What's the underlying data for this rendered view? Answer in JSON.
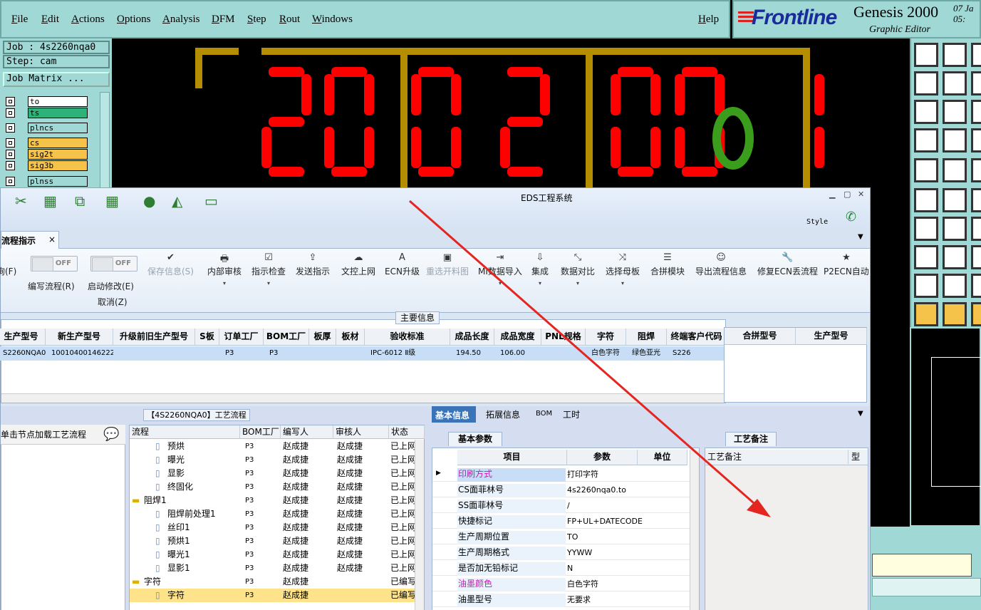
{
  "genesis": {
    "menu": [
      "File",
      "Edit",
      "Actions",
      "Options",
      "Analysis",
      "DFM",
      "Step",
      "Rout",
      "Windows"
    ],
    "help": "Help",
    "logo": "Frontline",
    "title": "Genesis 2000",
    "subtitle": "Graphic Editor",
    "date_line1": "07  Ja",
    "date_line2": "05:",
    "job": "Job : 4s2260nqa0",
    "step": "Step: cam",
    "job_matrix": "Job Matrix ...",
    "layers": [
      {
        "name": "to",
        "color": "#ffffff"
      },
      {
        "name": "ts",
        "color": "#2db37a"
      },
      {
        "name": "plncs",
        "color": "#9fd8d5"
      },
      {
        "name": "cs",
        "color": "#f5c34a"
      },
      {
        "name": "sig2t",
        "color": "#f5c34a"
      },
      {
        "name": "sig3b",
        "color": "#f5c34a"
      },
      {
        "name": "plnss",
        "color": "#9fd8d5"
      }
    ],
    "canvas_digits": "2002001"
  },
  "eds": {
    "window_title": "EDS工程系统",
    "style_label": "Style",
    "tab": "流程指示",
    "ribbon": [
      {
        "label": "询(F)",
        "icon": "",
        "disabled": false
      },
      {
        "label": "编写流程(R)",
        "icon": "toggle",
        "disabled": false
      },
      {
        "label": "启动修改(E)",
        "icon": "toggle",
        "disabled": false
      },
      {
        "label": "保存信息(S)",
        "icon": "✔",
        "disabled": true
      },
      {
        "label": "内部审核",
        "icon": "🖶",
        "disabled": false
      },
      {
        "label": "指示检查",
        "icon": "☑",
        "disabled": false
      },
      {
        "label": "发送指示",
        "icon": "⇪",
        "disabled": false
      },
      {
        "label": "文控上网",
        "icon": "☁",
        "disabled": false
      },
      {
        "label": "ECN升级",
        "icon": "A",
        "disabled": false
      },
      {
        "label": "重选开料图",
        "icon": "▣",
        "disabled": true
      },
      {
        "label": "MI数据导入",
        "icon": "⇥",
        "disabled": false
      },
      {
        "label": "集成",
        "icon": "⇩",
        "disabled": false
      },
      {
        "label": "数据对比",
        "icon": "⤡",
        "disabled": false
      },
      {
        "label": "选择母板",
        "icon": "⤨",
        "disabled": false
      },
      {
        "label": "合拼模块",
        "icon": "☰",
        "disabled": false
      },
      {
        "label": "导出流程信息",
        "icon": "☺",
        "disabled": false
      },
      {
        "label": "修复ECN丢流程",
        "icon": "🔧",
        "disabled": false
      },
      {
        "label": "P2ECN自动",
        "icon": "★",
        "disabled": false
      }
    ],
    "toggle_off": "OFF",
    "cancel_label": "取消(Z)",
    "main_info_label": "主要信息",
    "main_columns": [
      "生产型号",
      "新生产型号",
      "升级前旧生产型号",
      "S板",
      "订单工厂",
      "BOM工厂",
      "板厚",
      "板材",
      "验收标准",
      "成品长度",
      "成品宽度",
      "PNL规格",
      "字符",
      "阻焊",
      "终端客户代码"
    ],
    "main_row": [
      "S2260NQA0",
      "10010400146222",
      "",
      "",
      "P3",
      "P3",
      "",
      "",
      "IPC-6012 Ⅱ级",
      "194.50",
      "106.00",
      "",
      "白色字符",
      "绿色亚光",
      "S226"
    ],
    "side_columns": [
      "合拼型号",
      "生产型号"
    ],
    "process_title": "【4S2260NQA0】工艺流程",
    "left_hint": "单击节点加载工艺流程",
    "proc_columns": [
      "流程",
      "BOM工厂",
      "编写人",
      "审核人",
      "状态"
    ],
    "proc_rows": [
      {
        "name": "预烘",
        "bom": "P3",
        "writer": "赵成捷",
        "reviewer": "赵成捷",
        "status": "已上网",
        "indent": 2,
        "folder": false
      },
      {
        "name": "曝光",
        "bom": "P3",
        "writer": "赵成捷",
        "reviewer": "赵成捷",
        "status": "已上网",
        "indent": 2,
        "folder": false
      },
      {
        "name": "显影",
        "bom": "P3",
        "writer": "赵成捷",
        "reviewer": "赵成捷",
        "status": "已上网",
        "indent": 2,
        "folder": false
      },
      {
        "name": "终固化",
        "bom": "P3",
        "writer": "赵成捷",
        "reviewer": "赵成捷",
        "status": "已上网",
        "indent": 2,
        "folder": false
      },
      {
        "name": "阻焊1",
        "bom": "P3",
        "writer": "赵成捷",
        "reviewer": "赵成捷",
        "status": "已上网",
        "indent": 1,
        "folder": true
      },
      {
        "name": "阻焊前处理1",
        "bom": "P3",
        "writer": "赵成捷",
        "reviewer": "赵成捷",
        "status": "已上网",
        "indent": 2,
        "folder": false
      },
      {
        "name": "丝印1",
        "bom": "P3",
        "writer": "赵成捷",
        "reviewer": "赵成捷",
        "status": "已上网",
        "indent": 2,
        "folder": false
      },
      {
        "name": "预烘1",
        "bom": "P3",
        "writer": "赵成捷",
        "reviewer": "赵成捷",
        "status": "已上网",
        "indent": 2,
        "folder": false
      },
      {
        "name": "曝光1",
        "bom": "P3",
        "writer": "赵成捷",
        "reviewer": "赵成捷",
        "status": "已上网",
        "indent": 2,
        "folder": false
      },
      {
        "name": "显影1",
        "bom": "P3",
        "writer": "赵成捷",
        "reviewer": "赵成捷",
        "status": "已上网",
        "indent": 2,
        "folder": false
      },
      {
        "name": "字符",
        "bom": "P3",
        "writer": "赵成捷",
        "reviewer": "",
        "status": "已编写",
        "indent": 1,
        "folder": true
      },
      {
        "name": "字符",
        "bom": "P3",
        "writer": "赵成捷",
        "reviewer": "",
        "status": "已编写",
        "indent": 2,
        "folder": false,
        "selected": true
      }
    ],
    "info_tabs": [
      "基本信息",
      "拓展信息",
      "BOM",
      "工时"
    ],
    "basic_params_label": "基本参数",
    "param_columns": [
      "项目",
      "参数",
      "单位"
    ],
    "params": [
      {
        "key": "印刷方式",
        "value": "打印字符",
        "pink": true,
        "current": true
      },
      {
        "key": "CS面菲林号",
        "value": "4s2260nqa0.to"
      },
      {
        "key": "SS面菲林号",
        "value": "/"
      },
      {
        "key": "快捷标记",
        "value": "FP+UL+DATECODE"
      },
      {
        "key": "生产周期位置",
        "value": "TO"
      },
      {
        "key": "生产周期格式",
        "value": "YYWW"
      },
      {
        "key": "是否加无铅标记",
        "value": "N"
      },
      {
        "key": "油墨颜色",
        "value": "白色字符",
        "pink": true
      },
      {
        "key": "油墨型号",
        "value": "无要求"
      }
    ],
    "craft_label": "工艺备注",
    "craft_col": "工艺备注",
    "craft_col2": "型"
  }
}
